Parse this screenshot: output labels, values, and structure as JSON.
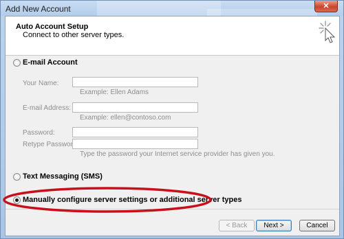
{
  "window": {
    "title": "Add New Account",
    "close_label": "✕"
  },
  "header": {
    "title": "Auto Account Setup",
    "subtitle": "Connect to other server types."
  },
  "options": {
    "email": {
      "label": "E-mail Account",
      "fields": {
        "name_label": "Your Name:",
        "name_value": "",
        "name_hint": "Example: Ellen Adams",
        "email_label": "E-mail Address:",
        "email_value": "",
        "email_hint": "Example: ellen@contoso.com",
        "password_label": "Password:",
        "password_value": "",
        "retype_label": "Retype Password:",
        "retype_value": "",
        "password_hint": "Type the password your Internet service provider has given you."
      }
    },
    "sms": {
      "label": "Text Messaging (SMS)"
    },
    "manual": {
      "label": "Manually configure server settings or additional server types",
      "selected": true
    }
  },
  "buttons": {
    "back": "< Back",
    "next": "Next >",
    "cancel": "Cancel"
  },
  "colors": {
    "highlight_ellipse": "#c8101c",
    "window_frame": "#a9c5e6"
  },
  "icons": {
    "wizard": "sparkle-cursor-icon"
  }
}
